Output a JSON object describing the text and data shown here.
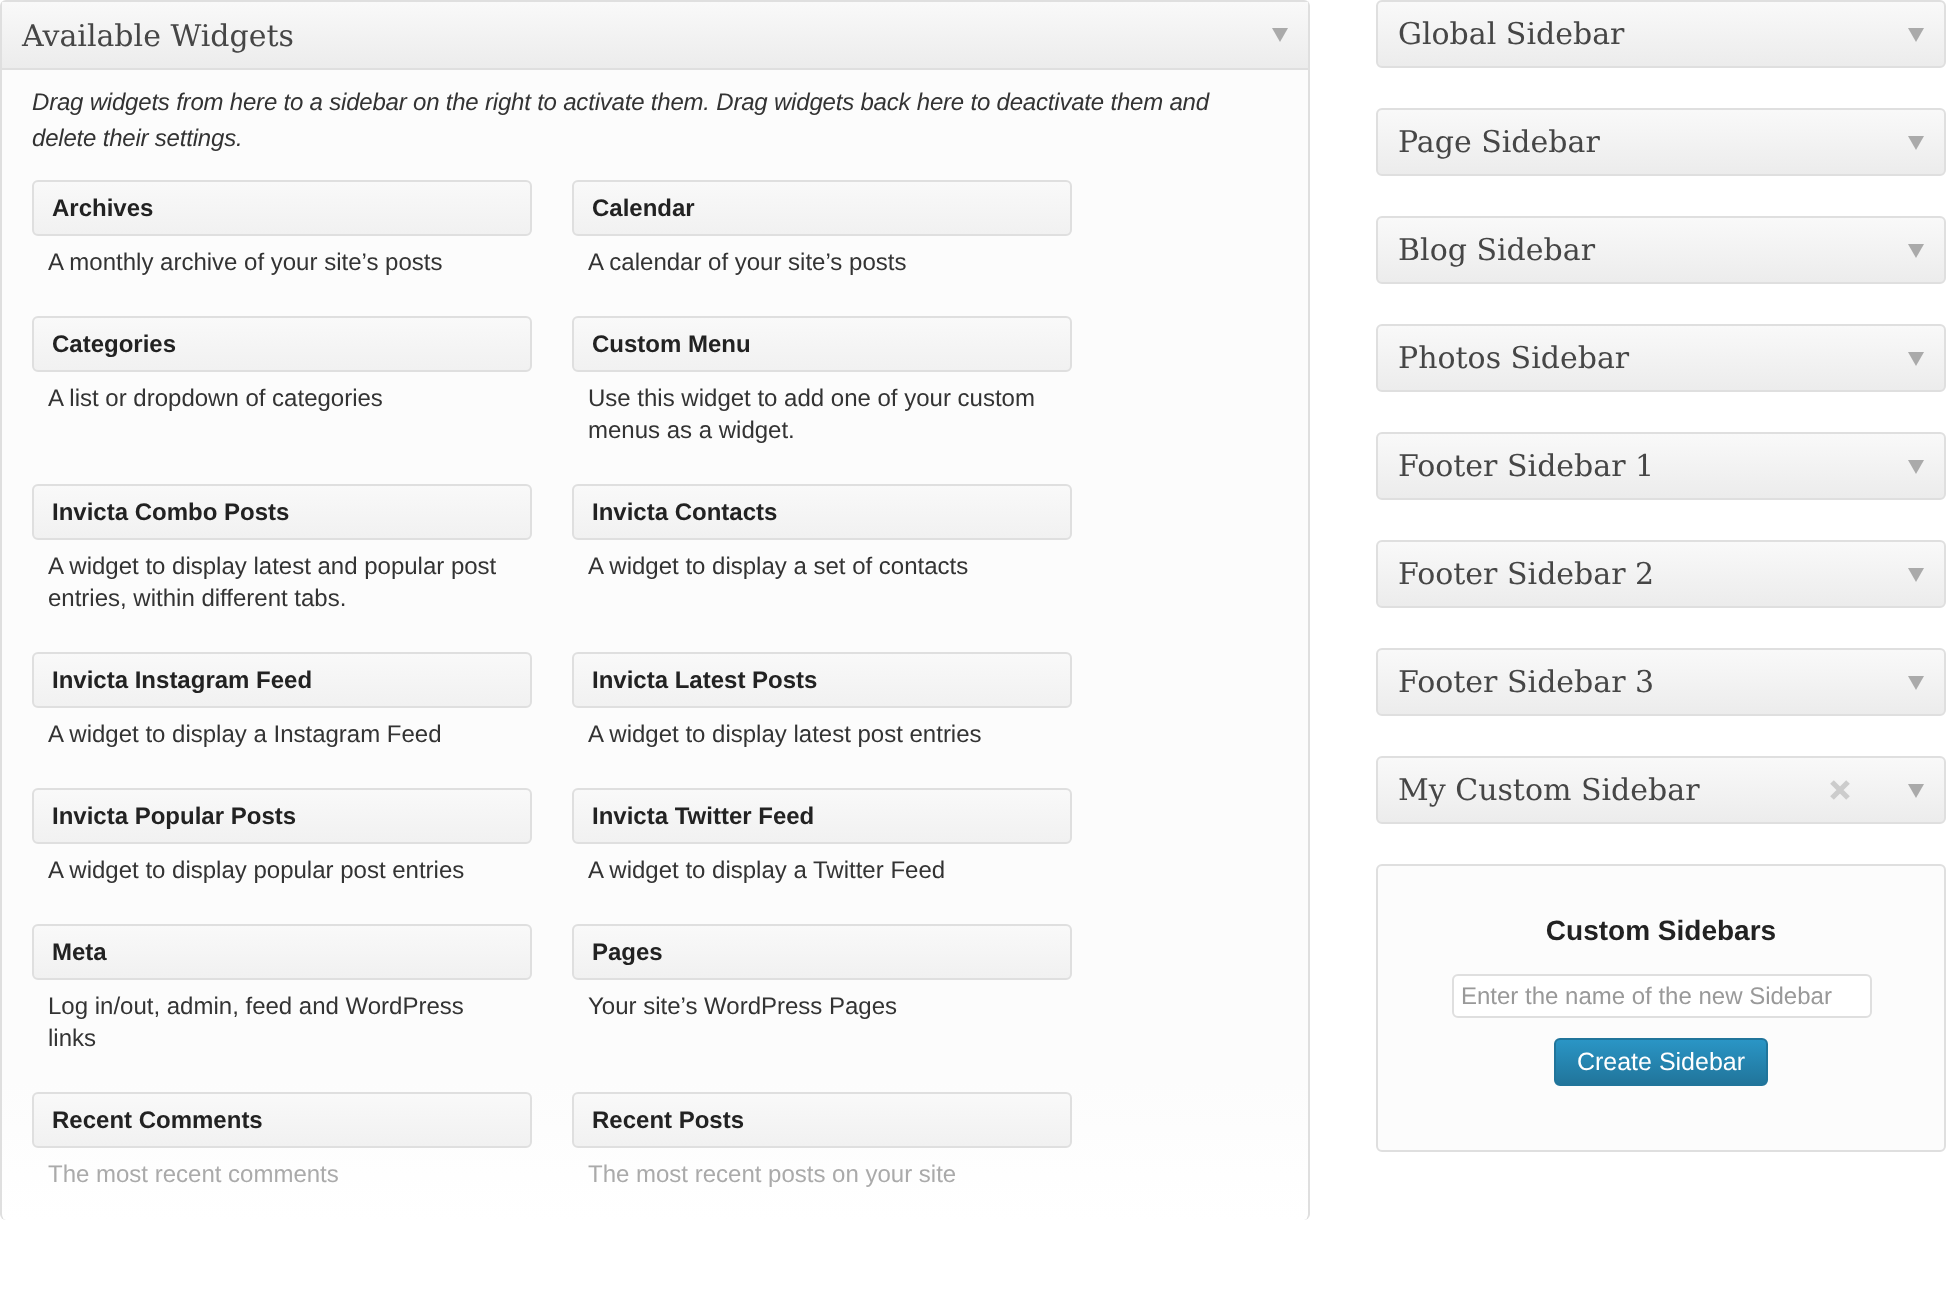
{
  "available_widgets": {
    "title": "Available Widgets",
    "description": "Drag widgets from here to a sidebar on the right to activate them. Drag widgets back here to deactivate them and delete their settings.",
    "widgets": [
      {
        "name": "Archives",
        "description": "A monthly archive of your site’s posts"
      },
      {
        "name": "Calendar",
        "description": "A calendar of your site’s posts"
      },
      {
        "name": "Categories",
        "description": "A list or dropdown of categories"
      },
      {
        "name": "Custom Menu",
        "description": "Use this widget to add one of your custom menus as a widget."
      },
      {
        "name": "Invicta Combo Posts",
        "description": "A widget to display latest and popular post entries, within different tabs."
      },
      {
        "name": "Invicta Contacts",
        "description": "A widget to display a set of contacts"
      },
      {
        "name": "Invicta Instagram Feed",
        "description": "A widget to display a Instagram Feed"
      },
      {
        "name": "Invicta Latest Posts",
        "description": "A widget to display latest post entries"
      },
      {
        "name": "Invicta Popular Posts",
        "description": "A widget to display popular post entries"
      },
      {
        "name": "Invicta Twitter Feed",
        "description": "A widget to display a Twitter Feed"
      },
      {
        "name": "Meta",
        "description": "Log in/out, admin, feed and WordPress links"
      },
      {
        "name": "Pages",
        "description": "Your site’s WordPress Pages"
      },
      {
        "name": "Recent Comments",
        "description": "The most recent comments"
      },
      {
        "name": "Recent Posts",
        "description": "The most recent posts on your site"
      }
    ]
  },
  "sidebars": [
    {
      "title": "Global Sidebar",
      "removable": false
    },
    {
      "title": "Page Sidebar",
      "removable": false
    },
    {
      "title": "Blog Sidebar",
      "removable": false
    },
    {
      "title": "Photos Sidebar",
      "removable": false
    },
    {
      "title": "Footer Sidebar 1",
      "removable": false
    },
    {
      "title": "Footer Sidebar 2",
      "removable": false
    },
    {
      "title": "Footer Sidebar 3",
      "removable": false
    },
    {
      "title": "My Custom Sidebar",
      "removable": true
    }
  ],
  "custom_sidebars": {
    "title": "Custom Sidebars",
    "placeholder": "Enter the name of the new Sidebar",
    "button": "Create Sidebar"
  }
}
